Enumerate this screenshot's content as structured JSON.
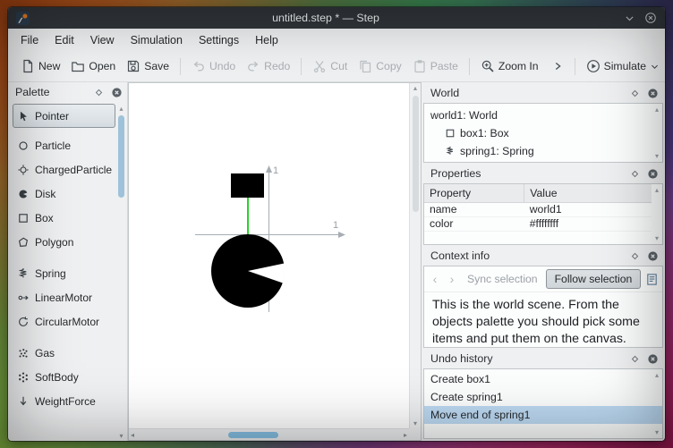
{
  "window": {
    "title": "untitled.step * — Step"
  },
  "menu": {
    "items": [
      "File",
      "Edit",
      "View",
      "Simulation",
      "Settings",
      "Help"
    ]
  },
  "toolbar": {
    "new": "New",
    "open": "Open",
    "save": "Save",
    "undo": "Undo",
    "redo": "Redo",
    "cut": "Cut",
    "copy": "Copy",
    "paste": "Paste",
    "zoom_in": "Zoom In",
    "simulate": "Simulate"
  },
  "palette": {
    "title": "Palette",
    "items": [
      {
        "label": "Pointer",
        "selected": true
      },
      {
        "label": "Particle",
        "selected": false
      },
      {
        "label": "ChargedParticle",
        "selected": false
      },
      {
        "label": "Disk",
        "selected": false
      },
      {
        "label": "Box",
        "selected": false
      },
      {
        "label": "Polygon",
        "selected": false
      },
      {
        "label": "Spring",
        "selected": false
      },
      {
        "label": "LinearMotor",
        "selected": false
      },
      {
        "label": "CircularMotor",
        "selected": false
      },
      {
        "label": "Gas",
        "selected": false
      },
      {
        "label": "SoftBody",
        "selected": false
      },
      {
        "label": "WeightForce",
        "selected": false
      }
    ]
  },
  "canvas": {
    "x_unit_label": "1",
    "y_unit_label": "1"
  },
  "world_panel": {
    "title": "World",
    "items": [
      {
        "label": "world1: World"
      },
      {
        "label": "box1: Box"
      },
      {
        "label": "spring1: Spring"
      }
    ]
  },
  "properties_panel": {
    "title": "Properties",
    "columns": {
      "property": "Property",
      "value": "Value"
    },
    "rows": [
      {
        "property": "name",
        "value": "world1"
      },
      {
        "property": "color",
        "value": "#ffffffff"
      }
    ]
  },
  "context_panel": {
    "title": "Context info",
    "sync_label": "Sync selection",
    "follow_label": "Follow selection",
    "follow_pressed": true,
    "body_text": "This is the world scene. From the objects palette you should pick some items and put them on the canvas."
  },
  "undo_panel": {
    "title": "Undo history",
    "items": [
      {
        "label": "Create box1",
        "selected": false
      },
      {
        "label": "Create spring1",
        "selected": false
      },
      {
        "label": "Move end of spring1",
        "selected": true
      }
    ]
  },
  "colors": {
    "titlebar": "#31363b",
    "accent": "#3daee9",
    "selection": "#bcd9f2",
    "spring_green": "#2bd12b"
  }
}
